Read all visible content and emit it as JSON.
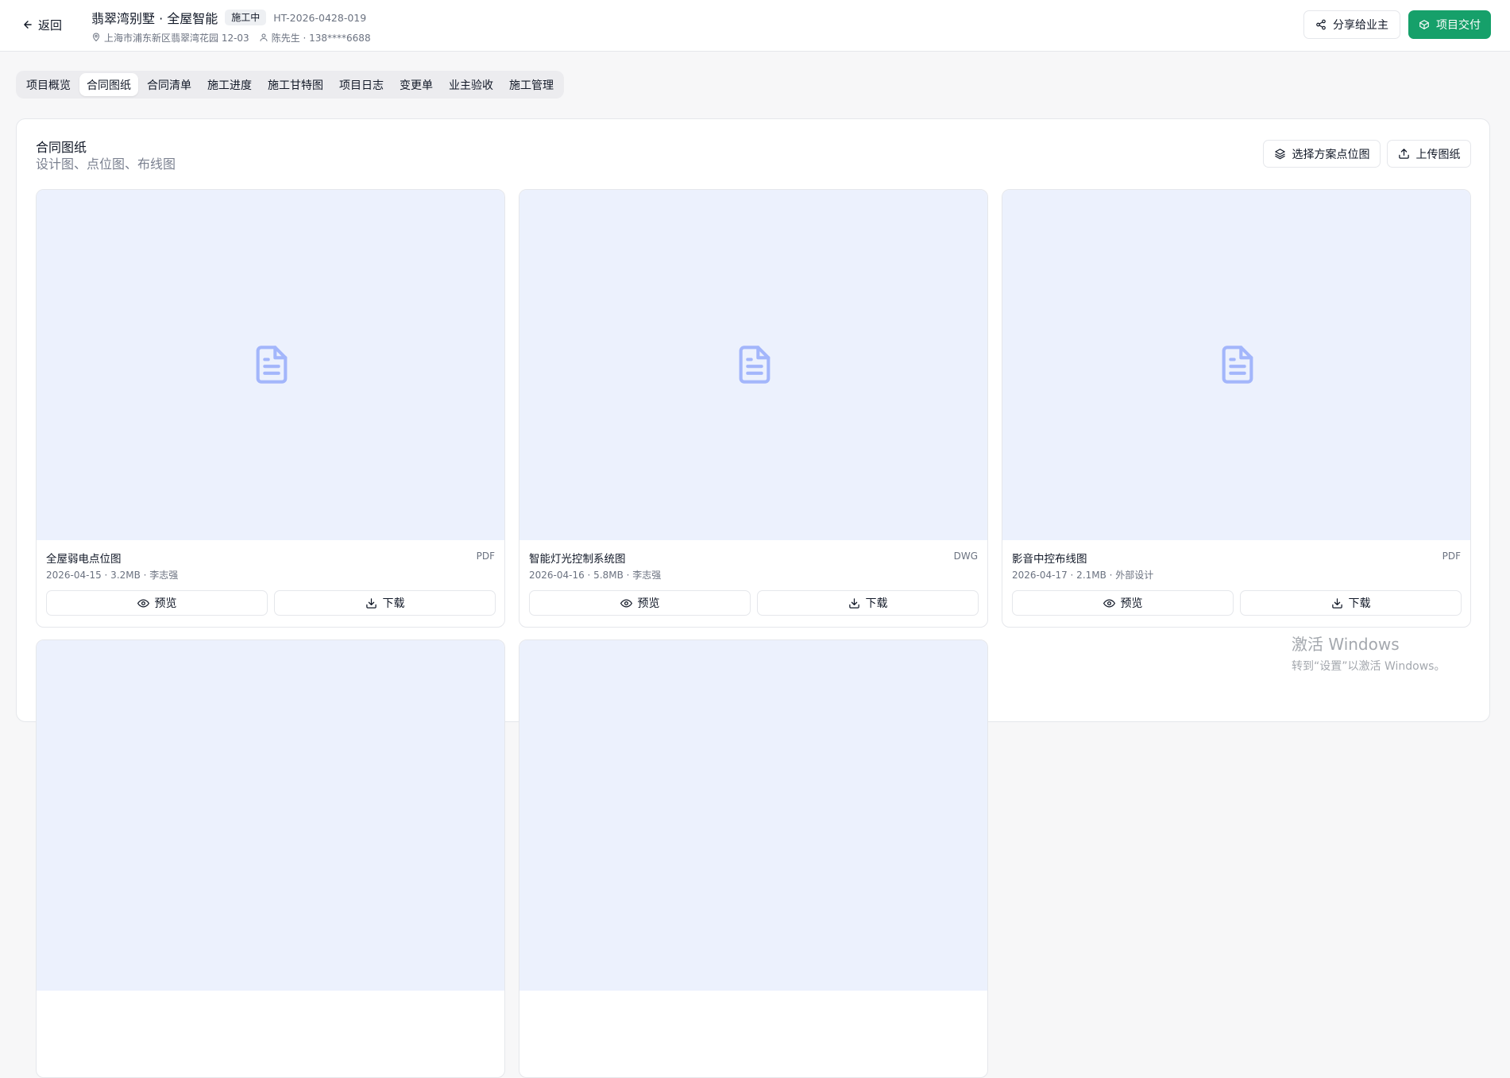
{
  "header": {
    "back_label": "返回",
    "title": "翡翠湾别墅 · 全屋智能",
    "status": "施工中",
    "contract_no": "HT-2026-0428-019",
    "address": "上海市浦东新区翡翠湾花园 12-03",
    "client": "陈先生 · 138****6688",
    "share_label": "分享给业主",
    "deliver_label": "项目交付",
    "accent_color": "#16a06a"
  },
  "tabs": [
    {
      "label": "项目概览",
      "active": false
    },
    {
      "label": "合同图纸",
      "active": true
    },
    {
      "label": "合同清单",
      "active": false
    },
    {
      "label": "施工进度",
      "active": false
    },
    {
      "label": "施工甘特图",
      "active": false
    },
    {
      "label": "项目日志",
      "active": false
    },
    {
      "label": "变更单",
      "active": false
    },
    {
      "label": "业主验收",
      "active": false
    },
    {
      "label": "施工管理",
      "active": false
    }
  ],
  "section": {
    "title": "合同图纸",
    "subtitle": "设计图、点位图、布线图",
    "select_label": "选择方案点位图",
    "upload_label": "上传图纸"
  },
  "drawings": [
    {
      "name": "全屋弱电点位图",
      "type": "PDF",
      "meta": "2026-04-15 · 3.2MB · 李志强",
      "preview_label": "预览",
      "download_label": "下载"
    },
    {
      "name": "智能灯光控制系统图",
      "type": "DWG",
      "meta": "2026-04-16 · 5.8MB · 李志强",
      "preview_label": "预览",
      "download_label": "下载"
    },
    {
      "name": "影音中控布线图",
      "type": "PDF",
      "meta": "2026-04-17 · 2.1MB · 外部设计",
      "preview_label": "预览",
      "download_label": "下载"
    }
  ],
  "watermark": {
    "title": "激活 Windows",
    "subtitle": "转到“设置”以激活 Windows。"
  }
}
